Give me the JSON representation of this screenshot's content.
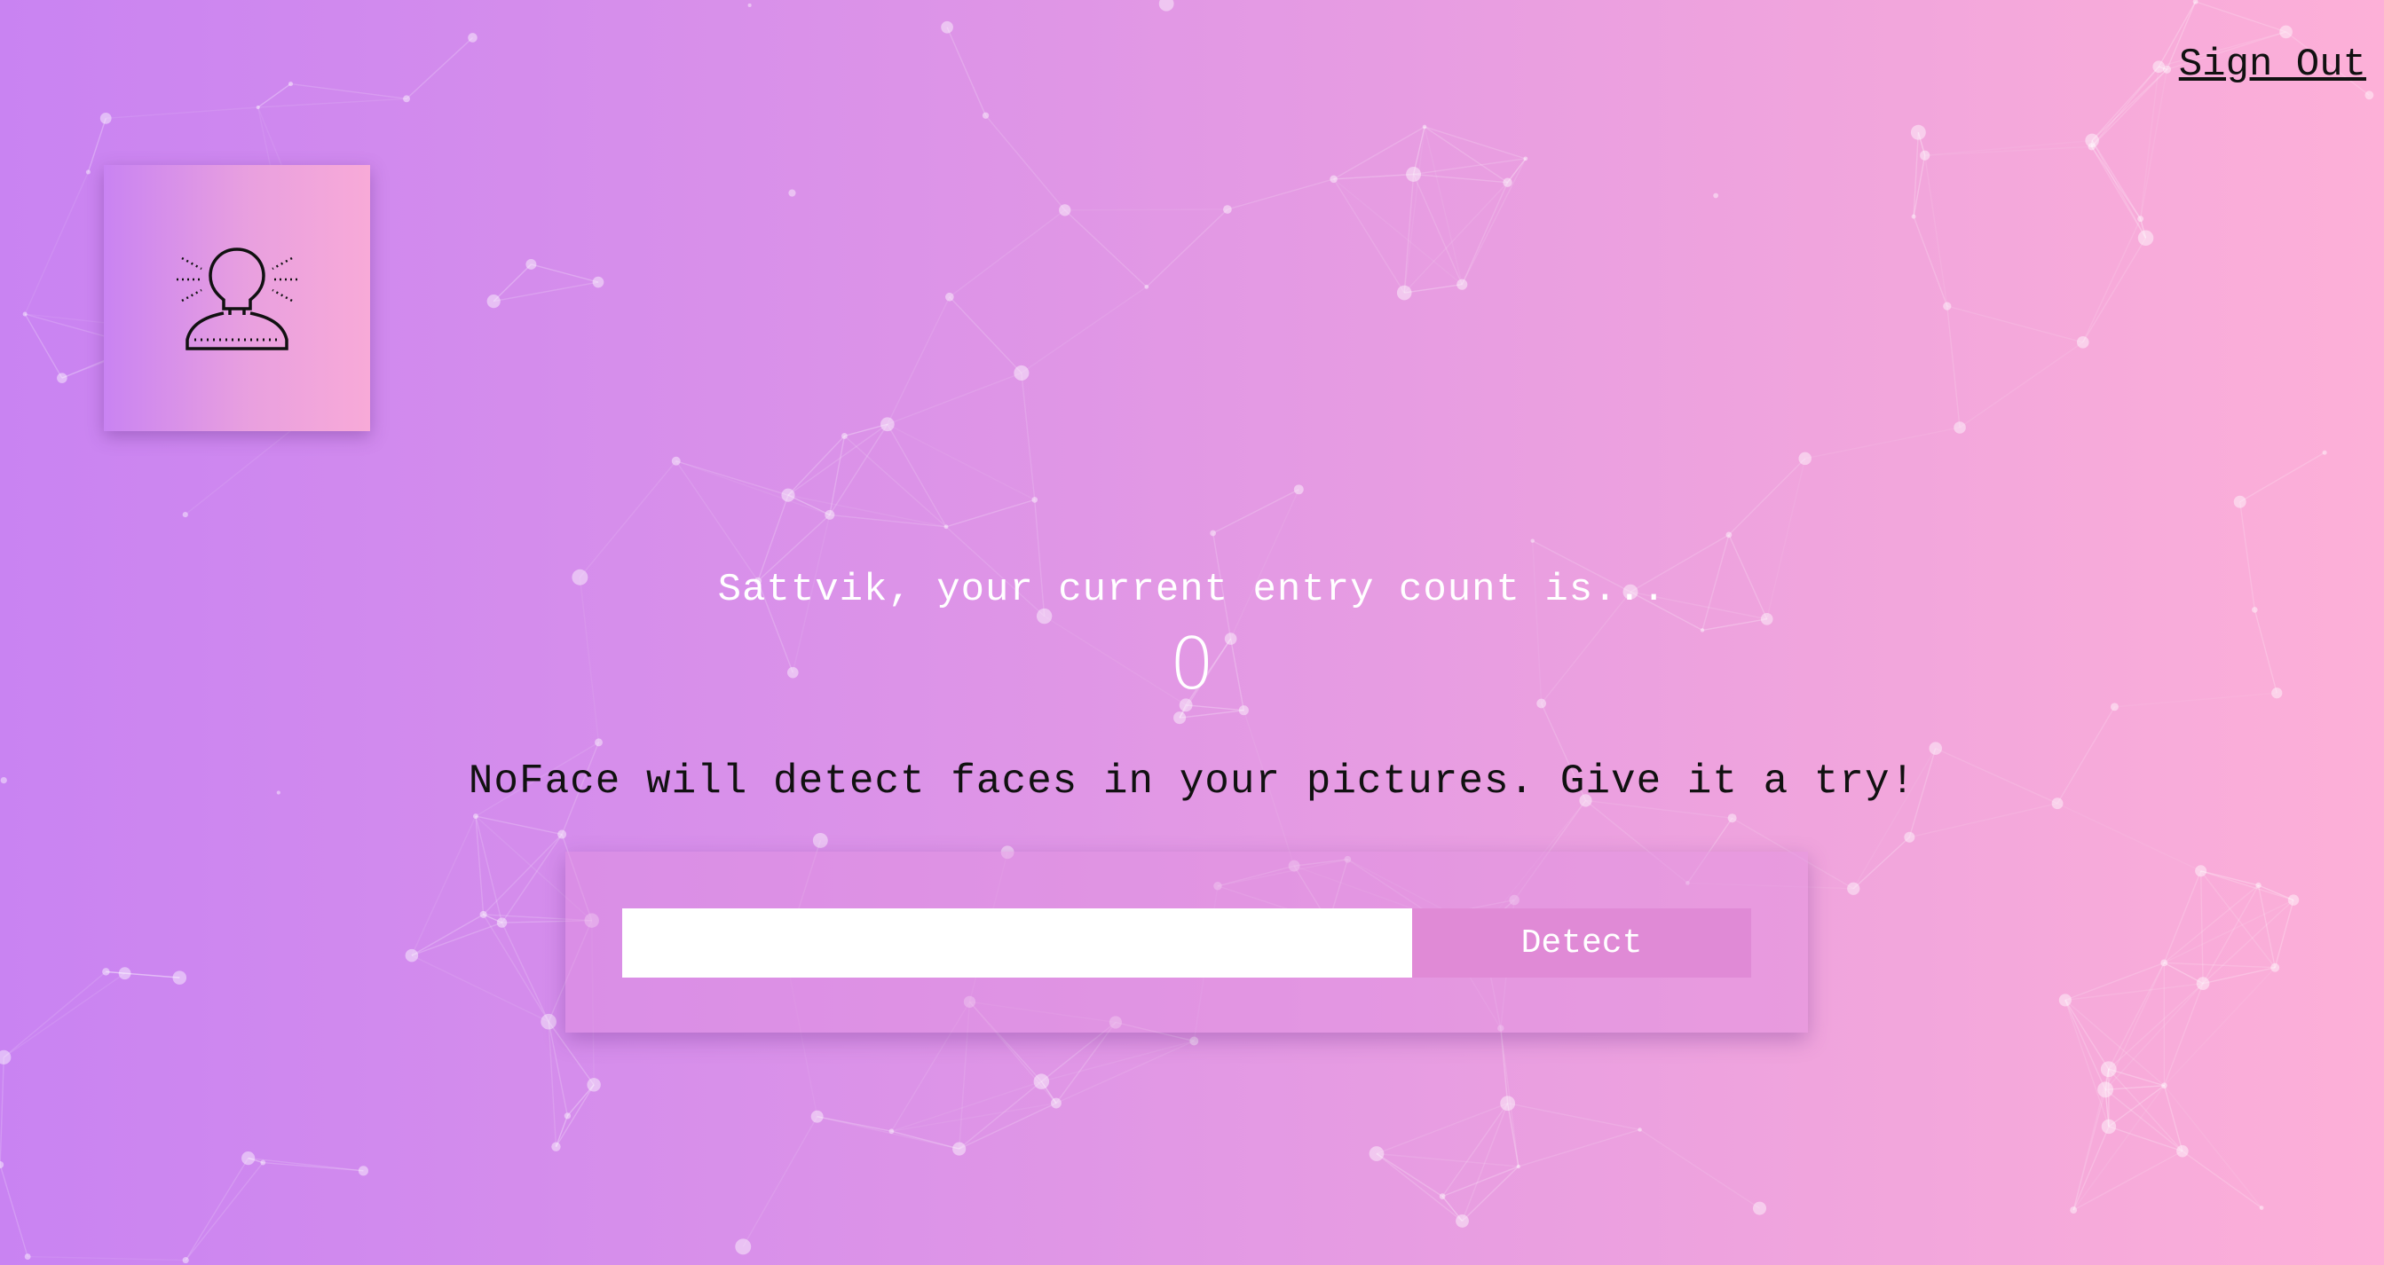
{
  "nav": {
    "signout_label": "Sign Out"
  },
  "logo": {
    "icon": "face-recognition-icon"
  },
  "rank": {
    "message": "Sattvik, your current entry count is...",
    "count": "0"
  },
  "intro": {
    "text": "NoFace will detect faces in your pictures. Give it a try!"
  },
  "image_form": {
    "input_value": "",
    "button_label": "Detect"
  },
  "background": {
    "style": "particle-network"
  }
}
